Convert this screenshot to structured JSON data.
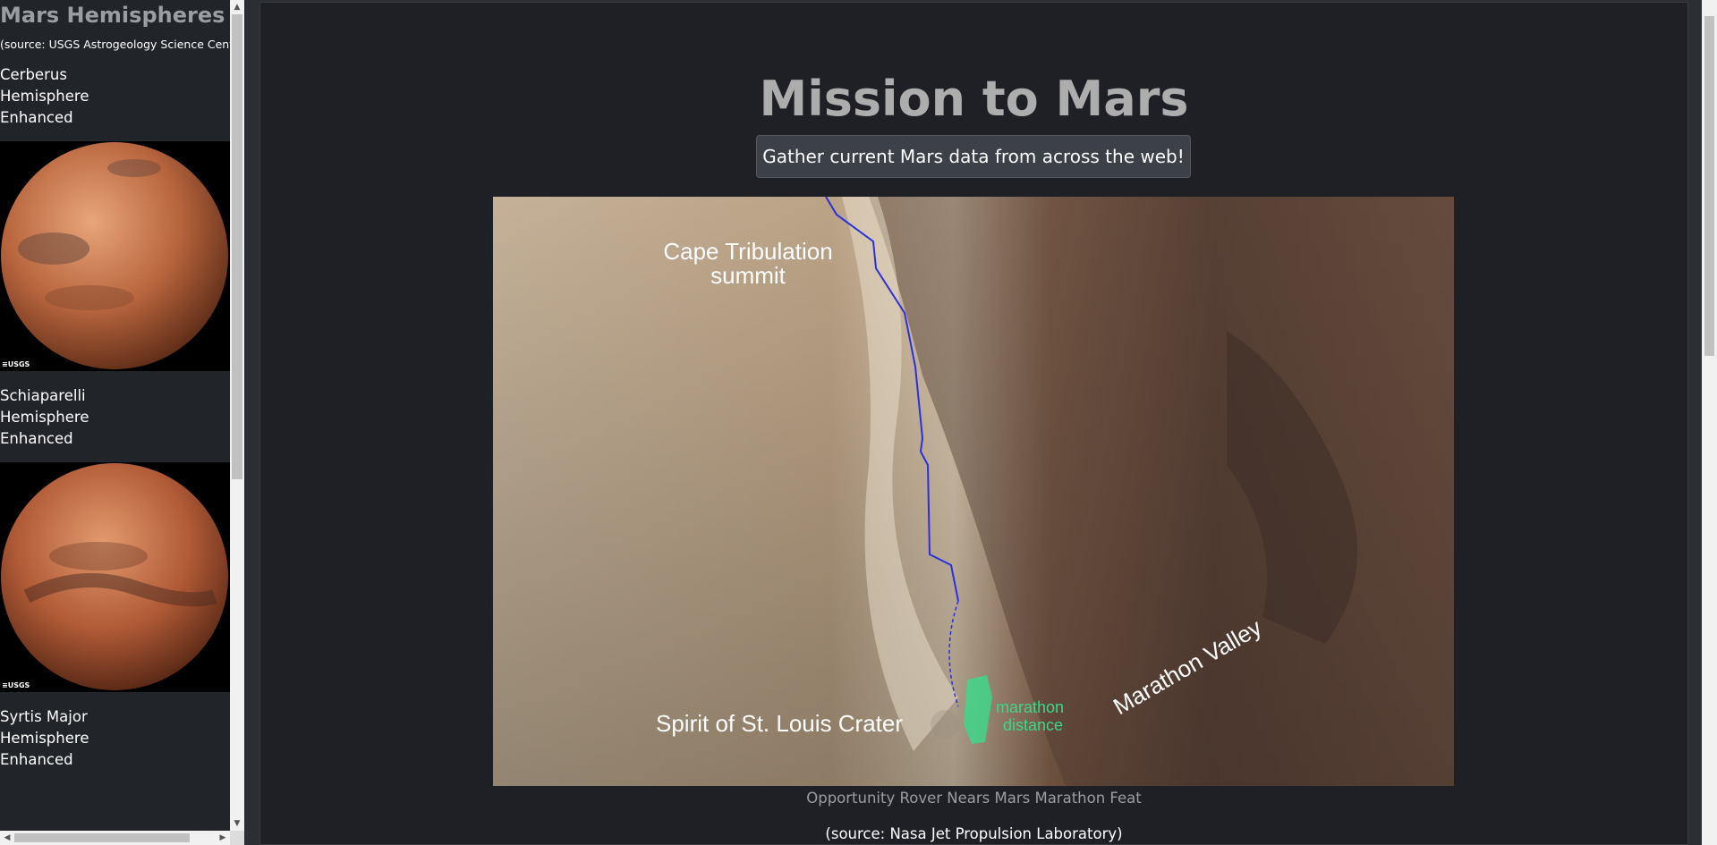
{
  "sidebar": {
    "title": "Mars Hemispheres",
    "source": "(source: USGS Astrogeology Science Center)",
    "hemispheres": [
      {
        "name": "Cerberus Hemisphere Enhanced",
        "logo": "≡USGS"
      },
      {
        "name": "Schiaparelli Hemisphere Enhanced",
        "logo": "≡USGS"
      },
      {
        "name": "Syrtis Major Hemisphere Enhanced"
      }
    ]
  },
  "main": {
    "title": "Mission to Mars",
    "button_label": "Gather current Mars data from across the web!",
    "featured_image": {
      "labels": {
        "cape": "Cape Tribulation",
        "summit": "summit",
        "valley": "Marathon Valley",
        "crater": "Spirit of St. Louis Crater",
        "marathon": "marathon",
        "distance": "distance"
      },
      "caption": "Opportunity Rover Nears Mars Marathon Feat",
      "source": "(source: Nasa Jet Propulsion Laboratory)"
    }
  },
  "colors": {
    "background": "#1e2025",
    "sidebar": "#212429",
    "rover_path": "#2a2fe0",
    "marathon_marker": "#3fd68a"
  }
}
